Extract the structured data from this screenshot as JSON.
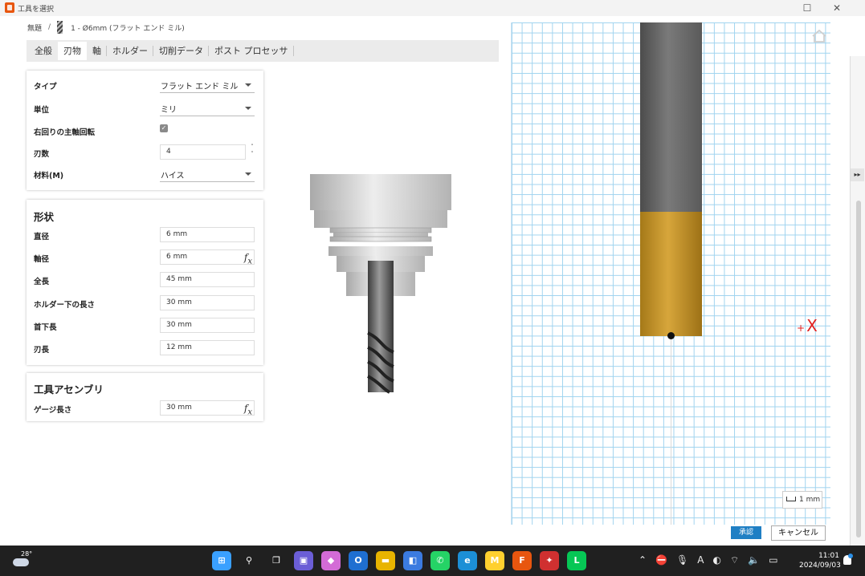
{
  "window": {
    "title": "工具を選択",
    "maximize_glyph": "☐",
    "close_glyph": "✕"
  },
  "breadcrumb": {
    "root": "無題",
    "separator": "/",
    "tool": "1 - Ø6mm (フラット エンド ミル)"
  },
  "tabs": [
    {
      "label": "全般"
    },
    {
      "label": "刃物"
    },
    {
      "label": "軸"
    },
    {
      "label": "ホルダー"
    },
    {
      "label": "切削データ"
    },
    {
      "label": "ポスト プロセッサ"
    }
  ],
  "cutter": {
    "type_label": "タイプ",
    "type_value": "フラット エンド ミル",
    "unit_label": "単位",
    "unit_value": "ミリ",
    "clockwise_label": "右回りの主軸回転",
    "clockwise_checked": true,
    "check_glyph": "✓",
    "flutes_label": "刃数",
    "flutes_value": "4",
    "stepper_up": "˄",
    "stepper_down": "˅",
    "material_label": "材料(M)",
    "material_value": "ハイス"
  },
  "geometry": {
    "title": "形状",
    "diameter_label": "直径",
    "diameter_value": "6 mm",
    "shaft_label": "軸径",
    "shaft_value": "6 mm",
    "overall_label": "全長",
    "overall_value": "45 mm",
    "below_holder_label": "ホルダー下の長さ",
    "below_holder_value": "30 mm",
    "shoulder_label": "首下長",
    "shoulder_value": "30 mm",
    "flute_label": "刃長",
    "flute_value": "12 mm",
    "fx": "f",
    "fx_sub": "x"
  },
  "assembly": {
    "title": "工具アセンブリ",
    "gauge_label": "ゲージ長さ",
    "gauge_value": "30 mm"
  },
  "preview": {
    "axis_label": "X",
    "axis_sign": "+",
    "scale": "1 mm",
    "shank_color": "#6a6a6a",
    "flute_color": "#c8962c"
  },
  "buttons": {
    "ok": "承認",
    "cancel": "キャンセル",
    "edge": "▸▸"
  },
  "taskbar": {
    "temperature": "28°",
    "time": "11:01",
    "date": "2024/09/03",
    "apps": [
      {
        "name": "start",
        "glyph": "⊞",
        "color": "#3aa0ff"
      },
      {
        "name": "search",
        "glyph": "⚲",
        "color": "#202020"
      },
      {
        "name": "task-view",
        "glyph": "❐",
        "color": "#202020"
      },
      {
        "name": "teams",
        "glyph": "▣",
        "color": "#6b5ed6"
      },
      {
        "name": "copilot",
        "glyph": "◆",
        "color": "#d36bd6"
      },
      {
        "name": "outlook",
        "glyph": "O",
        "color": "#1f6fd1"
      },
      {
        "name": "explorer",
        "glyph": "▬",
        "color": "#e8b400"
      },
      {
        "name": "store",
        "glyph": "◧",
        "color": "#3b7be0"
      },
      {
        "name": "whatsapp",
        "glyph": "✆",
        "color": "#25d366"
      },
      {
        "name": "edge",
        "glyph": "e",
        "color": "#1c8fd6"
      },
      {
        "name": "miro",
        "glyph": "M",
        "color": "#ffd02f"
      },
      {
        "name": "fusion",
        "glyph": "F",
        "color": "#e8560f"
      },
      {
        "name": "app-red",
        "glyph": "✦",
        "color": "#d03030"
      },
      {
        "name": "line",
        "glyph": "L",
        "color": "#06c755"
      }
    ],
    "tray": [
      "⌃",
      "⛔",
      "🎙",
      "A",
      "◐",
      "⌔",
      "🔈",
      "▭"
    ]
  }
}
